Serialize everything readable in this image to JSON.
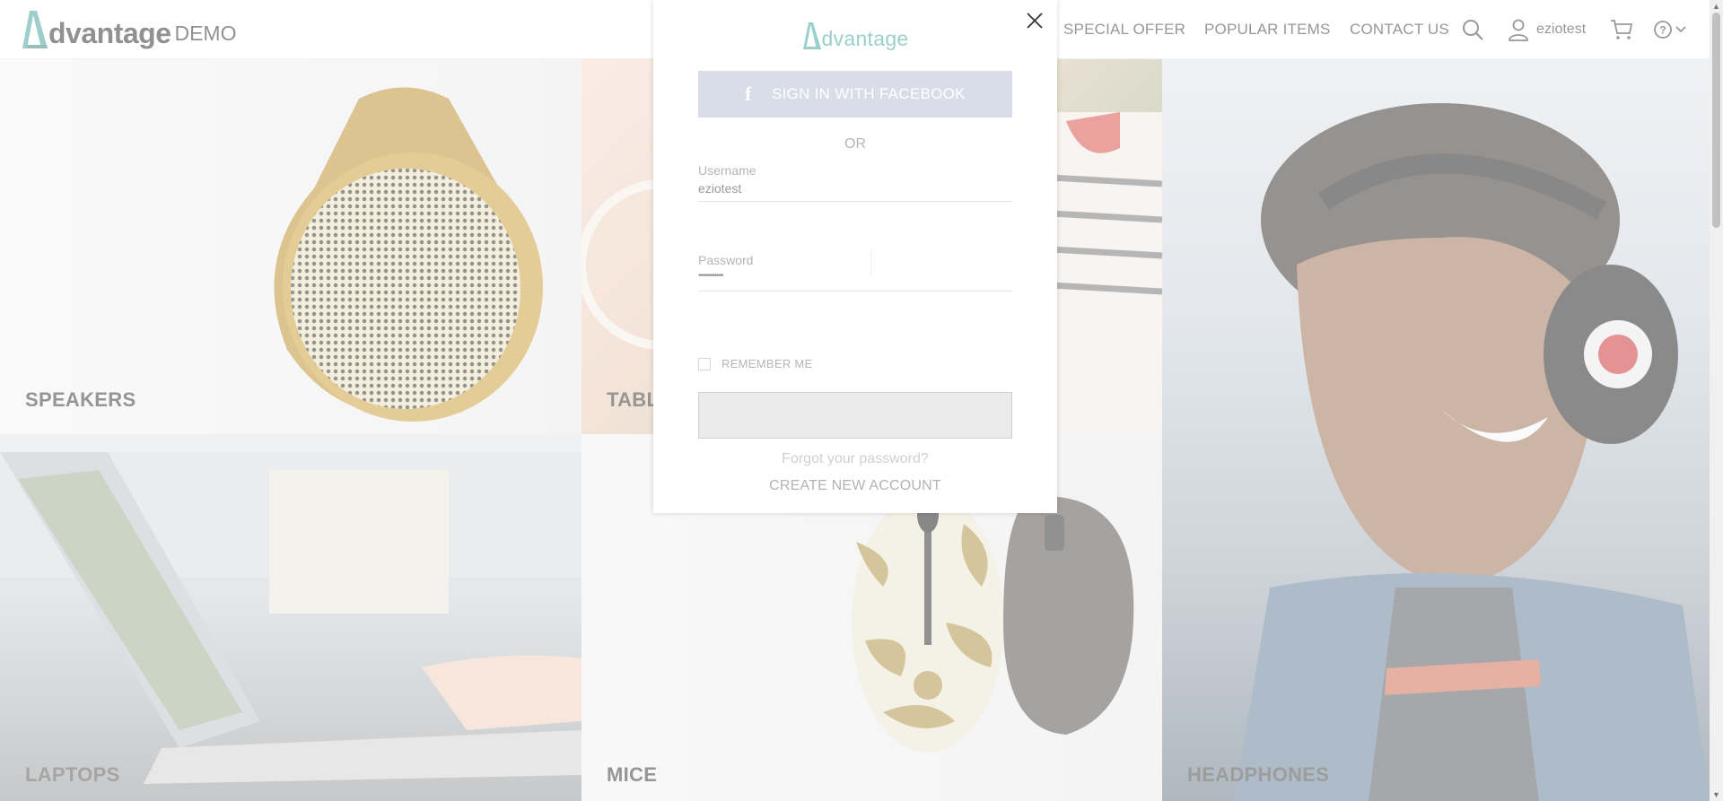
{
  "brand": {
    "logo_text": "dvantage",
    "logo_suffix": "DEMO",
    "accent": "#3d9c96"
  },
  "nav": {
    "special_offer": "SPECIAL OFFER",
    "popular_items": "POPULAR ITEMS",
    "contact_us": "CONTACT US",
    "username": "eziotest",
    "search_icon": "search-icon",
    "user_icon": "user-icon",
    "cart_icon": "cart-icon",
    "help_icon": "help-icon"
  },
  "categories": [
    {
      "label": "SPEAKERS"
    },
    {
      "label": "TABL"
    },
    {
      "label": "LAPTOPS"
    },
    {
      "label": "MICE"
    },
    {
      "label": "HEADPHONES"
    }
  ],
  "login_modal": {
    "logo_text": "dvantage",
    "facebook_button": "SIGN IN WITH FACEBOOK",
    "or_text": "OR",
    "username_label": "Username",
    "username_value": "eziotest",
    "password_label": "Password",
    "password_value": "•••••••••••",
    "remember_me": "REMEMBER ME",
    "remember_checked": false,
    "signin_button": "",
    "forgot_password": "Forgot your password?",
    "create_account": "CREATE NEW ACCOUNT",
    "facebook_color": "#d9dde7"
  }
}
